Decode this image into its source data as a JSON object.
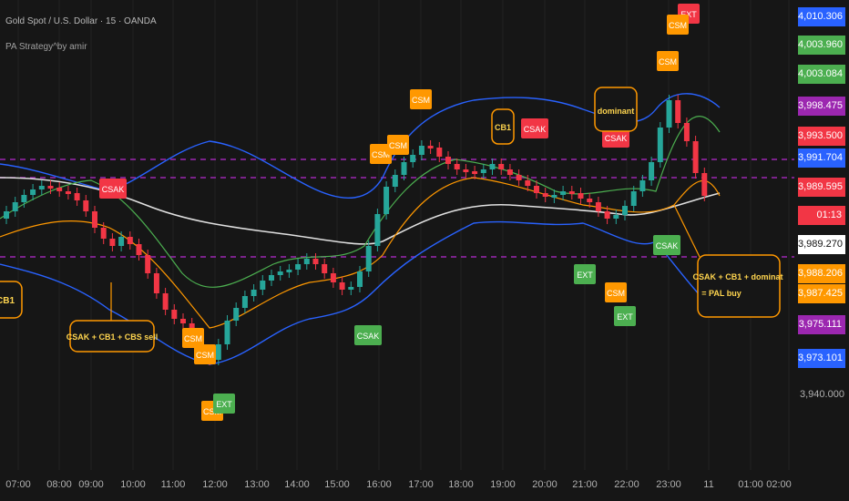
{
  "header": {
    "symbol": "Gold Spot / U.S. Dollar · 15 · OANDA",
    "indicator": "PA Strategy^by amir"
  },
  "price_tags": [
    {
      "text": "4,010.306",
      "color": "#2962ff"
    },
    {
      "text": "4,003.960",
      "color": "#4caf50"
    },
    {
      "text": "4,003.084",
      "color": "#4caf50"
    },
    {
      "text": "3,998.475",
      "color": "#9c27b0"
    },
    {
      "text": "3,993.500",
      "color": "#f23645"
    },
    {
      "text": "3,991.704",
      "color": "#2962ff"
    },
    {
      "text": "3,989.595",
      "color": "#f23645"
    },
    {
      "text": "01:13",
      "color": "#f23645"
    },
    {
      "text": "3,989.270",
      "color": "#ffffff"
    },
    {
      "text": "3,988.206",
      "color": "#ff9800"
    },
    {
      "text": "3,987.425",
      "color": "#ff9800"
    },
    {
      "text": "3,975.111",
      "color": "#9c27b0"
    },
    {
      "text": "3,973.101",
      "color": "#2962ff"
    }
  ],
  "price_label": "3,940.000",
  "time_labels": [
    "07:00",
    "08:00",
    "09:00",
    "10:00",
    "11:00",
    "12:00",
    "13:00",
    "14:00",
    "15:00",
    "16:00",
    "17:00",
    "18:00",
    "19:00",
    "20:00",
    "21:00",
    "22:00",
    "23:00",
    "11",
    "01:00",
    "02:00"
  ],
  "signals": [
    {
      "text": "CSAK",
      "color": "#f23645"
    },
    {
      "text": "CSM",
      "color": "#ff9800"
    },
    {
      "text": "CSM",
      "color": "#ff9800"
    },
    {
      "text": "CSM",
      "color": "#ff9800"
    },
    {
      "text": "CSAK",
      "color": "#f23645"
    },
    {
      "text": "CSAK",
      "color": "#f23645"
    },
    {
      "text": "CSM",
      "color": "#ff9800"
    },
    {
      "text": "EXT",
      "color": "#f23645"
    },
    {
      "text": "CSM",
      "color": "#ff9800"
    },
    {
      "text": "CSM",
      "color": "#ff9800"
    },
    {
      "text": "CSM",
      "color": "#ff9800"
    },
    {
      "text": "CSM",
      "color": "#ff9800"
    },
    {
      "text": "EXT",
      "color": "#4caf50"
    },
    {
      "text": "CSAK",
      "color": "#4caf50"
    },
    {
      "text": "EXT",
      "color": "#4caf50"
    },
    {
      "text": "CSM",
      "color": "#ff9800"
    },
    {
      "text": "EXT",
      "color": "#4caf50"
    },
    {
      "text": "CSAK",
      "color": "#4caf50"
    }
  ],
  "annotations": {
    "cb1_left": "CB1",
    "sell_note": "CSAK + CB1 + CBS sell",
    "cb1_top": "CB1",
    "dominant": "dominant",
    "buy_note_line1": "CSAK + CB1 + dominat",
    "buy_note_line2": "= PAL buy"
  },
  "colors": {
    "up": "#26a69a",
    "down": "#f23645",
    "level": "#9c27b0",
    "note": "#ff9800"
  }
}
